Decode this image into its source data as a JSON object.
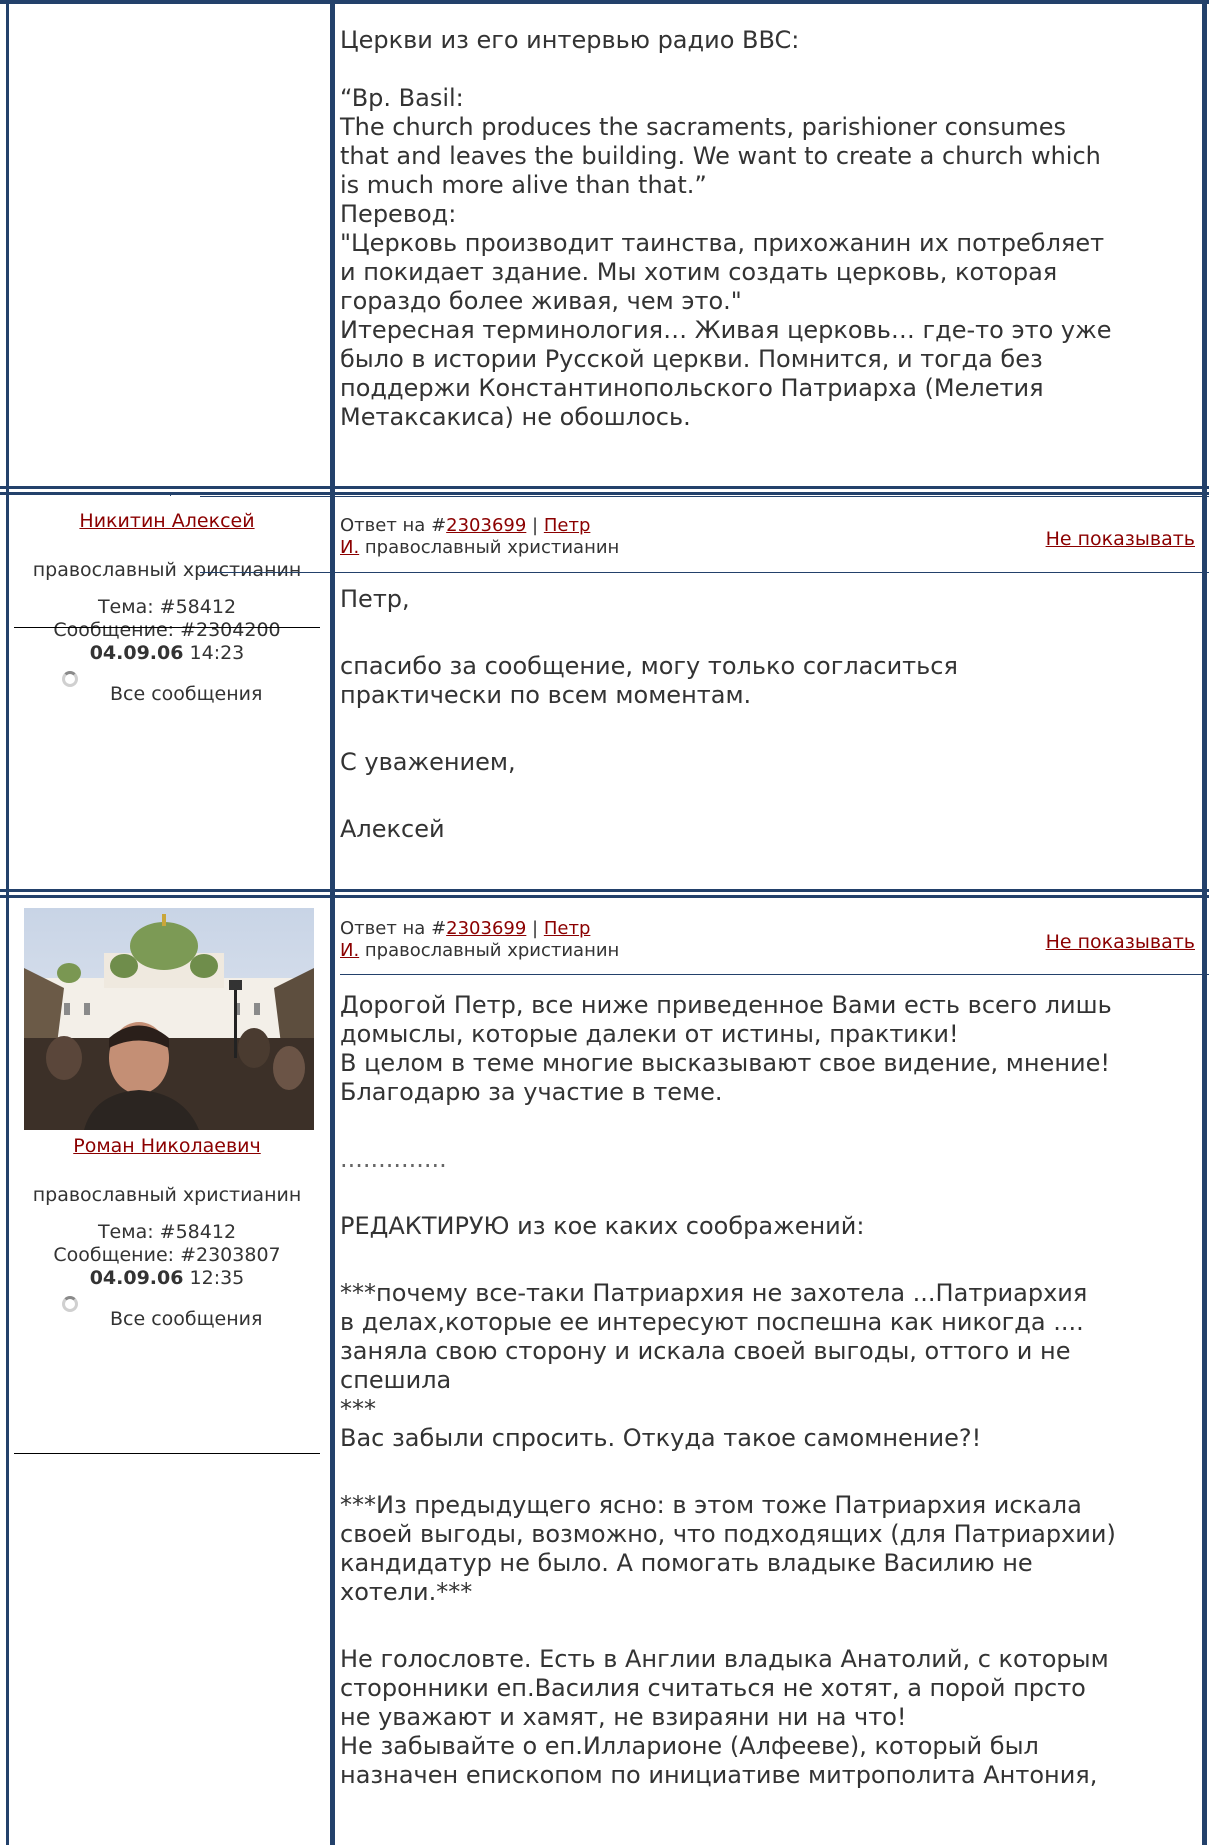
{
  "post1": {
    "lines": [
      "Церкви из его интервью радио BBC:",
      "",
      "“Bp. Basil:",
      "The church produces the sacraments, parishioner consumes",
      "that and leaves the building. We want to create a church which",
      "is much more alive than that.”",
      "Перевод:",
      "\"Церковь производит таинства, прихожанин их потребляет",
      "и покидает здание. Мы хотим создать церковь, которая",
      "гораздо более живая, чем это.\"",
      "Итересная терминология… Живая церковь… где-то это уже",
      "было в истории Русской церкви. Помнится, и тогда без",
      "поддержи Константинопольского Патриарха (Мелетия",
      "Метаксакиса) не обошлось."
    ]
  },
  "post2": {
    "author": "Никитин Алексей",
    "status": "православный христианин",
    "topic_label": "Тема: #58412",
    "message_label": "Сообщение: #2304200",
    "date": "04.09.06",
    "time": "14:23",
    "all_messages": "Все сообщения",
    "reply_prefix": "Ответ на #",
    "reply_id": "2303699",
    "reply_sep": " | ",
    "reply_author_1": "Петр",
    "reply_author_2": "И.",
    "reply_status": " православный христианин",
    "hide_label": "Не показывать",
    "lines": [
      "Петр,",
      "",
      "спасибо за сообщение, могу только согласиться",
      "практически по всем моментам.",
      "",
      "С уважением,",
      "",
      "Алексей"
    ]
  },
  "post3": {
    "author": "Роман Николаевич",
    "status": "православный христианин",
    "topic_label": "Тема: #58412",
    "message_label": "Сообщение: #2303807",
    "date": "04.09.06",
    "time": "12:35",
    "all_messages": "Все сообщения",
    "reply_prefix": "Ответ на #",
    "reply_id": "2303699",
    "reply_sep": " | ",
    "reply_author_1": "Петр",
    "reply_author_2": "И.",
    "reply_status": " православный христианин",
    "hide_label": "Не показывать",
    "lines": [
      "Дорогой Петр, все ниже приведенное Вами есть всего лишь",
      "домыслы, которые далеки от истины, практики!",
      "В целом в теме многие высказывают свое видение, мнение!",
      "Благодарю за участие в теме.",
      "",
      "..............",
      "",
      "РЕДАКТИРУЮ из кое каких соображений:",
      "",
      "***почему все-таки Патриархия не захотела ...Патриархия",
      "в делах,которые ее интересуют поспешна как никогда ....",
      "заняла свою сторону и искала своей выгоды, оттого и не",
      "спешила",
      "***",
      "Вас забыли спросить. Откуда такое самомнение?!",
      "",
      "***Из предыдущего ясно: в этом тоже Патриархия искала",
      "своей выгоды, возможно, что подходящих (для Патриархии)",
      "кандидатур не было. А помогать владыке Василию не",
      "хотели.***",
      "",
      "Не голословте. Есть в Англии владыка Анатолий, с которым",
      "сторонники еп.Василия считаться не хотят, а порой прсто",
      "не уважают и хамят, не взираяни ни на что!",
      "Не забывайте о еп.Илларионе (Алфееве), который был",
      "назначен епископом по инициативе митрополита Антония,"
    ]
  }
}
